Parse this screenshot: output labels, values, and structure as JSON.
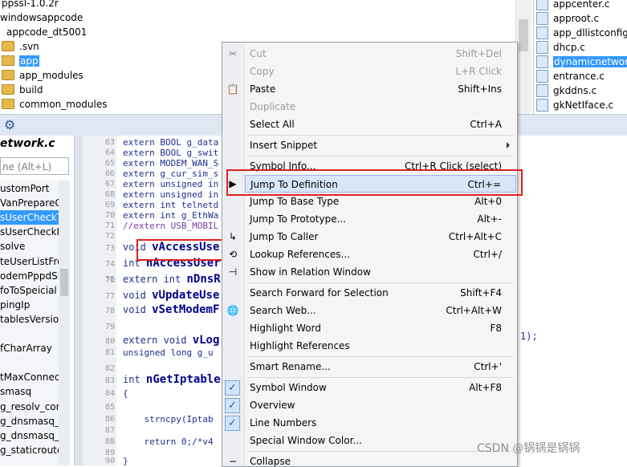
{
  "tree": {
    "rows": [
      {
        "label": "ppssl-1.0.2r",
        "folder": false,
        "indent": 2
      },
      {
        "label": "windowsappcode",
        "folder": false,
        "indent": 0
      },
      {
        "label": "appcode_dt5001",
        "folder": false,
        "indent": 8
      },
      {
        "label": ".svn",
        "folder": true,
        "indent": 0
      },
      {
        "label": "app",
        "folder": true,
        "indent": 0,
        "selected": true
      },
      {
        "label": "app_modules",
        "folder": true,
        "indent": 0
      },
      {
        "label": "build",
        "folder": true,
        "indent": 0
      },
      {
        "label": "common_modules",
        "folder": true,
        "indent": 0
      }
    ]
  },
  "files": {
    "rows": [
      {
        "label": "appcenter.c"
      },
      {
        "label": "approot.c"
      },
      {
        "label": "app_dllistconfig"
      },
      {
        "label": "dhcp.c"
      },
      {
        "label": "dynamicnetwork",
        "selected": true
      },
      {
        "label": "entrance.c"
      },
      {
        "label": "gkddns.c"
      },
      {
        "label": "gkNetIface.c"
      }
    ]
  },
  "toolbar": {
    "gear_icon": "gear-icon"
  },
  "symbols": {
    "title": "etwork.c",
    "search_placeholder": "ne (Alt+L)",
    "items": [
      {
        "label": "ustomPort"
      },
      {
        "label": "VanPrepareC"
      },
      {
        "label": "sUserCheckT",
        "selected": true
      },
      {
        "label": "sUserCheckI"
      },
      {
        "label": "solve"
      },
      {
        "label": "teUserListFro"
      },
      {
        "label": "odemPppdSi"
      },
      {
        "label": "foToSpeicial"
      },
      {
        "label": "pingIp"
      },
      {
        "label": "tablesVersio"
      },
      {
        "label": ""
      },
      {
        "label": "fCharArray"
      },
      {
        "label": ""
      },
      {
        "label": "tMaxConnec"
      },
      {
        "label": "smasq"
      },
      {
        "label": "g_resolv_con"
      },
      {
        "label": "g_dnsmasq_r"
      },
      {
        "label": "g_dnsmasq_c"
      },
      {
        "label": "g_staticroute"
      }
    ]
  },
  "editor": {
    "lines": [
      {
        "no": "63",
        "text": "extern BOOL g_data"
      },
      {
        "no": "64",
        "text": "extern BOOL g_swit"
      },
      {
        "no": "65",
        "text": "extern MODEM_WAN_S"
      },
      {
        "no": "66",
        "text": "extern g_cur_sim_s"
      },
      {
        "no": "67",
        "text": "extern unsigned in"
      },
      {
        "no": "68",
        "text": "extern unsigned in"
      },
      {
        "no": "69",
        "text": "extern int telnetd"
      },
      {
        "no": "70",
        "text": "extern int g_EthWa"
      },
      {
        "no": "71",
        "text": "//extern USB_MOBIL"
      },
      {
        "no": "72",
        "text": ""
      },
      {
        "no": "73",
        "text_pre": "void ",
        "text_fn": "vAccessUse"
      },
      {
        "no": "74",
        "text_pre": "int ",
        "text_fn": "nAccessUser"
      },
      {
        "no": "75",
        "text": ""
      },
      {
        "no": "76",
        "text_pre": "extern int ",
        "text_fn": "nDnsR"
      },
      {
        "no": "77",
        "text_pre": "void ",
        "text_fn": "vUpdateUse"
      },
      {
        "no": "78",
        "text_pre": "void ",
        "text_fn": "vSetModemF"
      },
      {
        "no": "79",
        "text": ""
      },
      {
        "no": "80",
        "text_pre": "extern void ",
        "text_fn": "vLog"
      },
      {
        "no": "81",
        "text": "unsigned long g_u"
      },
      {
        "no": "82",
        "text": ""
      },
      {
        "no": "83",
        "text_pre": "int ",
        "text_fn": "nGetIptable"
      },
      {
        "no": "84",
        "text": "{"
      },
      {
        "no": "85",
        "text": ""
      },
      {
        "no": "86",
        "text": "    strncpy(Iptab"
      },
      {
        "no": "87",
        "text": ""
      },
      {
        "no": "88",
        "text": "    return 0;/*v4"
      },
      {
        "no": "89",
        "text": ""
      },
      {
        "no": "90",
        "text": "}"
      }
    ],
    "tail_text": "1);"
  },
  "menu": {
    "items": [
      {
        "label": "Cut",
        "shortcut": "Shift+Del",
        "disabled": true,
        "icon": "scissors-icon"
      },
      {
        "label": "Copy",
        "shortcut": "L+R Click",
        "disabled": true,
        "icon": ""
      },
      {
        "label": "Paste",
        "shortcut": "Shift+Ins",
        "disabled": false,
        "icon": "paste-icon"
      },
      {
        "label": "Duplicate",
        "shortcut": "",
        "disabled": true,
        "icon": ""
      },
      {
        "label": "Select All",
        "shortcut": "Ctrl+A",
        "disabled": false,
        "icon": ""
      },
      {
        "sep": true
      },
      {
        "label": "Insert Snippet",
        "shortcut": "",
        "disabled": false,
        "submenu": true
      },
      {
        "sep": true
      },
      {
        "label": "Symbol Info...",
        "shortcut": "Ctrl+R Click (select)",
        "disabled": false
      },
      {
        "label": "Jump To Definition",
        "shortcut": "Ctrl+=",
        "disabled": false,
        "highlighted": true,
        "icon": "jump-icon"
      },
      {
        "label": "Jump To Base Type",
        "shortcut": "Alt+0",
        "disabled": false
      },
      {
        "label": "Jump To Prototype...",
        "shortcut": "Alt+-",
        "disabled": false
      },
      {
        "label": "Jump To Caller",
        "shortcut": "Ctrl+Alt+C",
        "disabled": false,
        "icon": "caller-icon"
      },
      {
        "label": "Lookup References...",
        "shortcut": "Ctrl+/",
        "disabled": false,
        "icon": "references-icon"
      },
      {
        "label": "Show in Relation Window",
        "shortcut": "",
        "disabled": false,
        "icon": "relation-icon"
      },
      {
        "sep": true
      },
      {
        "label": "Search Forward for Selection",
        "shortcut": "Shift+F4",
        "disabled": false
      },
      {
        "label": "Search Web...",
        "shortcut": "Ctrl+Alt+W",
        "disabled": false,
        "icon": "web-icon"
      },
      {
        "label": "Highlight Word",
        "shortcut": "F8",
        "disabled": false
      },
      {
        "label": "Highlight References",
        "shortcut": "",
        "disabled": false
      },
      {
        "sep": true
      },
      {
        "label": "Smart Rename...",
        "shortcut": "Ctrl+'",
        "disabled": false
      },
      {
        "sep": true
      },
      {
        "label": "Symbol Window",
        "shortcut": "Alt+F8",
        "disabled": false,
        "checked": true
      },
      {
        "label": "Overview",
        "shortcut": "",
        "disabled": false,
        "checked": true
      },
      {
        "label": "Line Numbers",
        "shortcut": "",
        "disabled": false,
        "checked": true
      },
      {
        "label": "Special Window Color...",
        "shortcut": "",
        "disabled": false
      },
      {
        "sep": true
      },
      {
        "label": "Collapse",
        "shortcut": "",
        "disabled": false,
        "icon": "collapse-icon"
      }
    ]
  },
  "watermark": "CSDN @锅锅是锅锅",
  "colors": {
    "selection": "#3399ff",
    "annotation_red": "#e02020",
    "menu_highlight": "#d8e6f7"
  }
}
